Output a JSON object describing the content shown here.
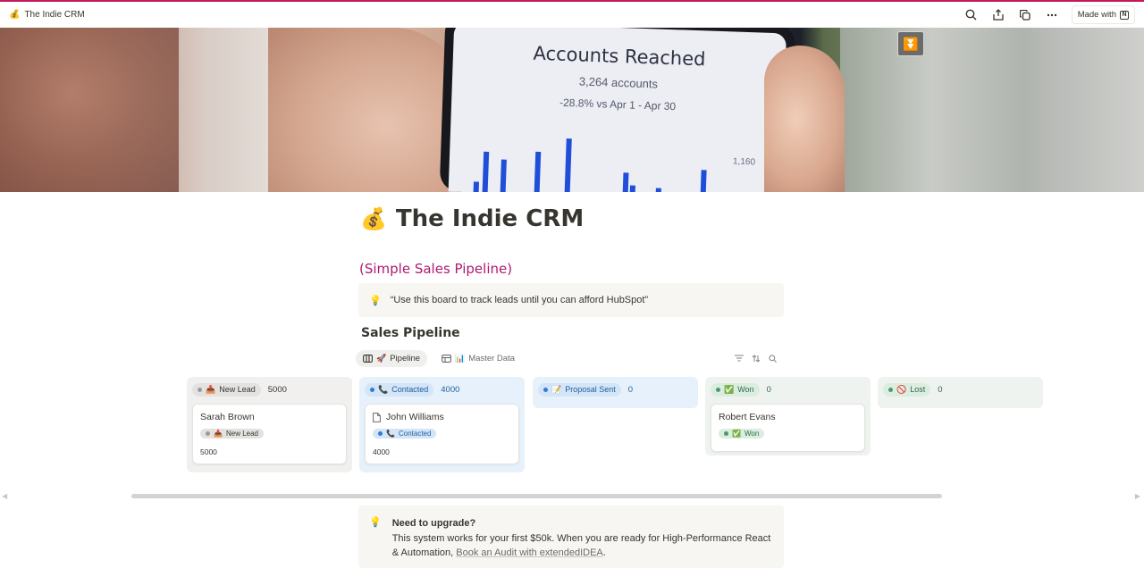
{
  "topbar": {
    "emoji": "💰",
    "title": "The Indie CRM",
    "made_with": "Made with",
    "logo_letter": "N"
  },
  "cover": {
    "phone_title": "Accounts Reached",
    "phone_accounts": "3,264 accounts",
    "phone_compare": "-28.8% vs Apr 1 - Apr 30",
    "phone_value": "1,160"
  },
  "page": {
    "emoji": "💰",
    "title": "The Indie CRM",
    "subtitle": "(Simple Sales Pipeline)",
    "callout_icon": "lightbulb-icon",
    "callout_text": "“Use this board to track leads until you can afford HubSpot”",
    "section_title": "Sales Pipeline"
  },
  "views": {
    "pipeline_icon": "🚀",
    "pipeline_label": "Pipeline",
    "master_icon": "📊",
    "master_label": "Master Data"
  },
  "columns": [
    {
      "emoji": "📥",
      "label": "New Lead",
      "count": "5000",
      "color": "#9b9a97",
      "bg": "#f1f0ee",
      "pillbg": "#e3e2e0",
      "text": "#37352f",
      "cards": [
        {
          "name": "Sarah Brown",
          "status_emoji": "📥",
          "status": "New Lead",
          "amount": "5000"
        }
      ]
    },
    {
      "emoji": "📞",
      "label": "Contacted",
      "count": "4000",
      "color": "#2e7dd7",
      "bg": "#e7f1fb",
      "pillbg": "#d3e5f7",
      "text": "#1f5f9f",
      "cards": [
        {
          "name": "John Williams",
          "status_emoji": "📞",
          "status": "Contacted",
          "amount": "4000"
        }
      ]
    },
    {
      "emoji": "📝",
      "label": "Proposal Sent",
      "count": "0",
      "color": "#2e7dd7",
      "bg": "#e7f1fb",
      "pillbg": "#d3e5f7",
      "text": "#1f5f9f",
      "cards": []
    },
    {
      "emoji": "✅",
      "label": "Won",
      "count": "0",
      "color": "#4c9a6a",
      "bg": "#eef3ef",
      "pillbg": "#dbece0",
      "text": "#2f6b47",
      "cards": [
        {
          "name": "Robert Evans",
          "status_emoji": "✅",
          "status": "Won",
          "amount": ""
        }
      ]
    },
    {
      "emoji": "🚫",
      "label": "Lost",
      "count": "0",
      "color": "#4c9a6a",
      "bg": "#eef3ef",
      "pillbg": "#dbece0",
      "text": "#2f6b47",
      "cards": []
    }
  ],
  "upgrade": {
    "icon": "lightbulb-icon",
    "heading": "Need to upgrade?",
    "body": "This system works for your first $50k. When you are ready for High-Performance React & Automation, ",
    "link": "Book an Audit with extendedIDEA",
    "end": "."
  }
}
